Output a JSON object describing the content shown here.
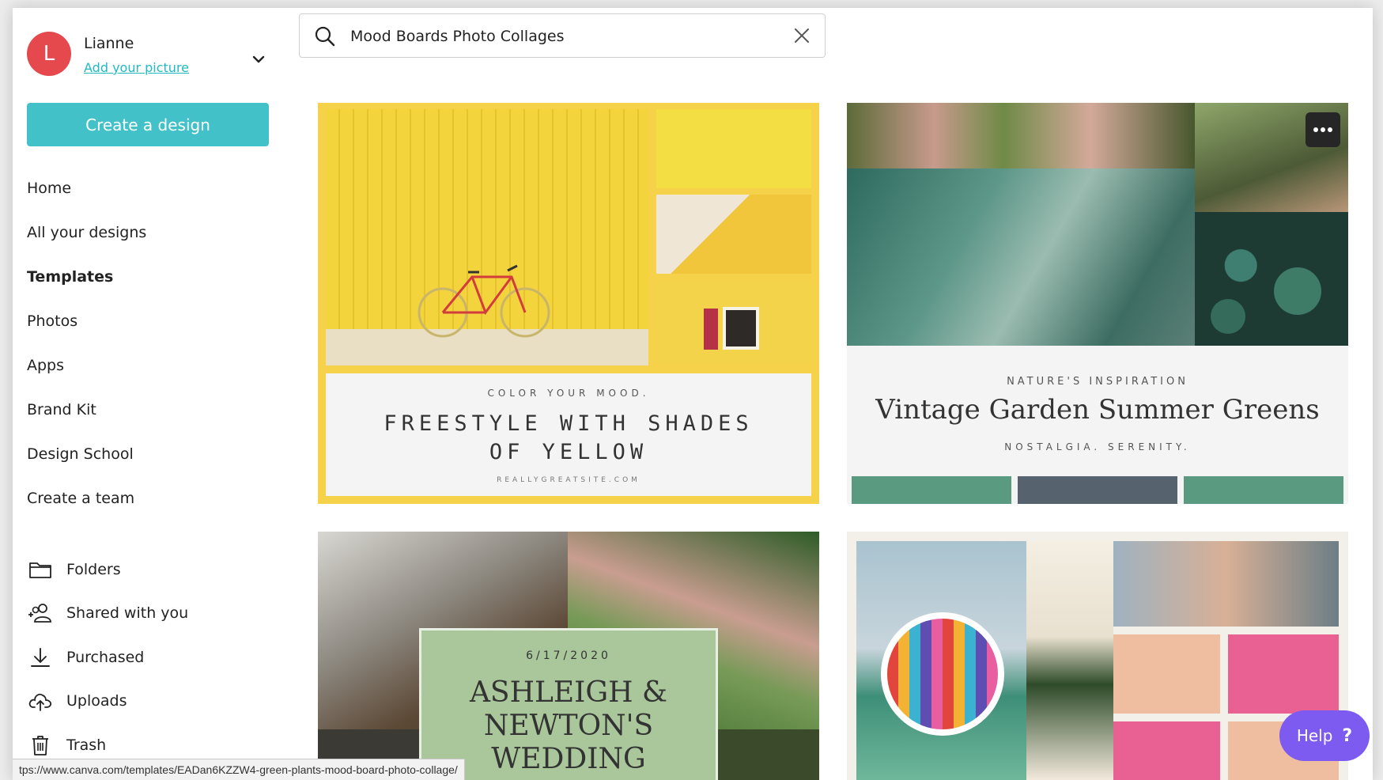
{
  "user": {
    "initial": "L",
    "name": "Lianne",
    "add_picture": "Add your picture"
  },
  "sidebar": {
    "create_label": "Create a design",
    "nav": [
      {
        "label": "Home"
      },
      {
        "label": "All your designs"
      },
      {
        "label": "Templates",
        "active": true
      },
      {
        "label": "Photos"
      },
      {
        "label": "Apps"
      },
      {
        "label": "Brand Kit"
      },
      {
        "label": "Design School"
      },
      {
        "label": "Create a team"
      }
    ],
    "secondary": [
      {
        "label": "Folders",
        "icon": "folder-icon"
      },
      {
        "label": "Shared with you",
        "icon": "shared-users-icon"
      },
      {
        "label": "Purchased",
        "icon": "download-icon"
      },
      {
        "label": "Uploads",
        "icon": "cloud-upload-icon"
      },
      {
        "label": "Trash",
        "icon": "trash-icon"
      }
    ]
  },
  "search": {
    "value": "Mood Boards Photo Collages"
  },
  "cards": {
    "yellow": {
      "kicker": "COLOR YOUR MOOD.",
      "title_line1": "FREESTYLE WITH SHADES",
      "title_line2": "OF YELLOW",
      "site": "REALLYGREATSITE.COM"
    },
    "garden": {
      "kicker": "NATURE'S INSPIRATION",
      "title": "Vintage Garden Summer Greens",
      "sub": "NOSTALGIA. SERENITY."
    },
    "wedding": {
      "date": "6/17/2020",
      "line1": "ASHLEIGH &",
      "line2": "NEWTON'S",
      "line3": "WEDDING"
    }
  },
  "colors": {
    "accent": "#43c1c8",
    "avatar": "#e5484d",
    "help": "#7d5af0",
    "yellow": "#f5d24a"
  },
  "status_url": "tps://www.canva.com/templates/EADan6KZZW4-green-plants-mood-board-photo-collage/",
  "help_label": "Help",
  "help_glyph": "?"
}
